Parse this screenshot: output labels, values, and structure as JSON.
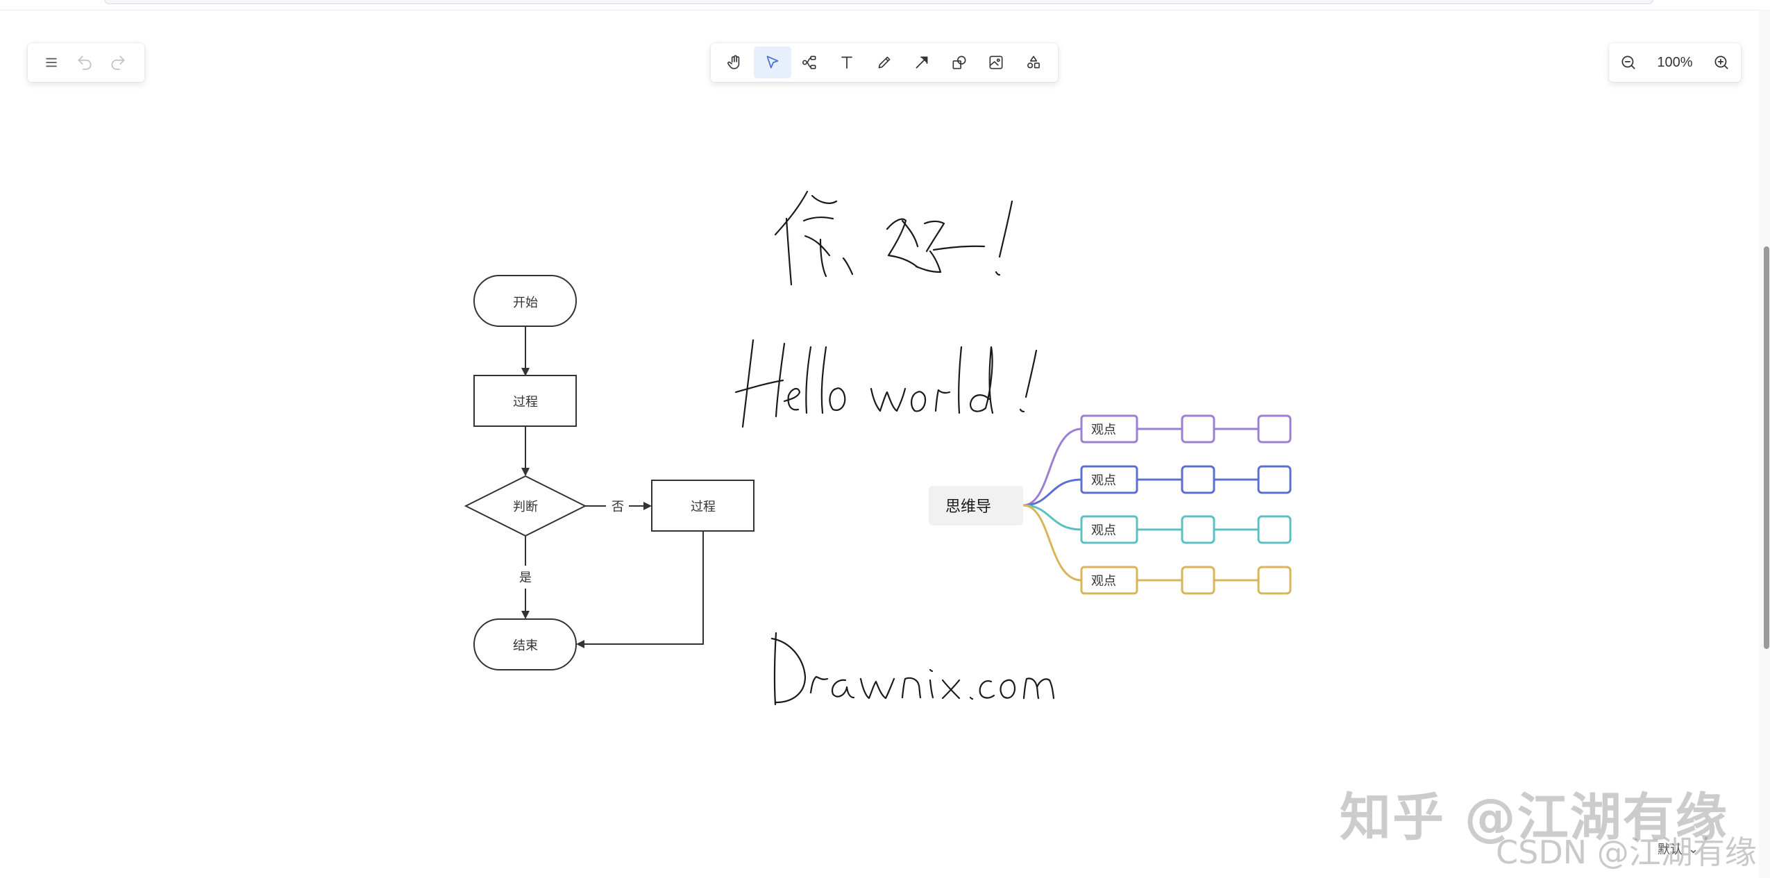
{
  "toolbar_left": {
    "menu_icon": "menu-icon",
    "undo_icon": "undo-icon",
    "redo_icon": "redo-icon"
  },
  "toolbar_center": {
    "tools": [
      {
        "name": "hand",
        "icon": "hand-icon"
      },
      {
        "name": "selection",
        "icon": "pointer-icon",
        "active": true
      },
      {
        "name": "mind",
        "icon": "mindmap-icon"
      },
      {
        "name": "text",
        "icon": "text-icon"
      },
      {
        "name": "pen",
        "icon": "pen-icon"
      },
      {
        "name": "arrow",
        "icon": "arrow-icon"
      },
      {
        "name": "shape",
        "icon": "shape-icon"
      },
      {
        "name": "image",
        "icon": "image-icon"
      },
      {
        "name": "extra",
        "icon": "more-shapes-icon"
      }
    ],
    "active_color": "#e7eefc"
  },
  "toolbar_right": {
    "zoom_level": "100%",
    "zoom_out_icon": "zoom-out-icon",
    "zoom_in_icon": "zoom-in-icon"
  },
  "flowchart": {
    "start": "开始",
    "process1": "过程",
    "decision": "判断",
    "no_label": "否",
    "process2": "过程",
    "yes_label": "是",
    "end": "结束"
  },
  "mindmap": {
    "root": "思维导",
    "branches": [
      {
        "label": "观点",
        "color": "#9b7fd3"
      },
      {
        "label": "观点",
        "color": "#5b6fd0"
      },
      {
        "label": "观点",
        "color": "#5cc0c0"
      },
      {
        "label": "观点",
        "color": "#d9b45a"
      }
    ]
  },
  "handwriting": {
    "line1": "你好！",
    "line2": "Hello world！",
    "line3": "Drawnix.com"
  },
  "watermarks": {
    "zhihu": "知乎 @江湖有缘",
    "csdn": "CSDN @江湖有缘"
  },
  "theme_select": "默认"
}
